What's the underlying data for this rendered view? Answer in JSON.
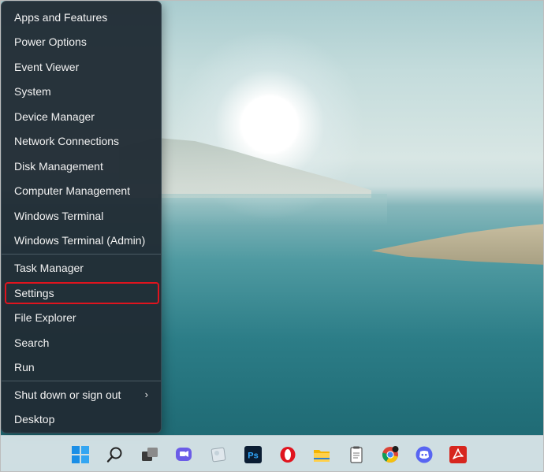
{
  "menu": {
    "items": [
      {
        "label": "Apps and Features"
      },
      {
        "label": "Power Options"
      },
      {
        "label": "Event Viewer"
      },
      {
        "label": "System"
      },
      {
        "label": "Device Manager"
      },
      {
        "label": "Network Connections"
      },
      {
        "label": "Disk Management"
      },
      {
        "label": "Computer Management"
      },
      {
        "label": "Windows Terminal"
      },
      {
        "label": "Windows Terminal (Admin)"
      },
      {
        "label": "Task Manager"
      },
      {
        "label": "Settings",
        "highlighted": true
      },
      {
        "label": "File Explorer"
      },
      {
        "label": "Search"
      },
      {
        "label": "Run"
      },
      {
        "label": "Shut down or sign out",
        "has_submenu": true
      },
      {
        "label": "Desktop"
      }
    ]
  },
  "taskbar": {
    "icons": [
      {
        "name": "start-icon"
      },
      {
        "name": "search-icon"
      },
      {
        "name": "task-view-icon"
      },
      {
        "name": "chat-icon"
      },
      {
        "name": "widgets-icon"
      },
      {
        "name": "photoshop-icon",
        "text": "Ps"
      },
      {
        "name": "opera-icon"
      },
      {
        "name": "file-explorer-icon"
      },
      {
        "name": "notepad-icon"
      },
      {
        "name": "chrome-icon"
      },
      {
        "name": "discord-icon"
      },
      {
        "name": "acrobat-icon"
      }
    ]
  },
  "colors": {
    "menu_bg": "#202c34",
    "menu_text": "#f2f2f2",
    "highlight_border": "#e0141e",
    "taskbar_bg": "#e2ebee"
  }
}
